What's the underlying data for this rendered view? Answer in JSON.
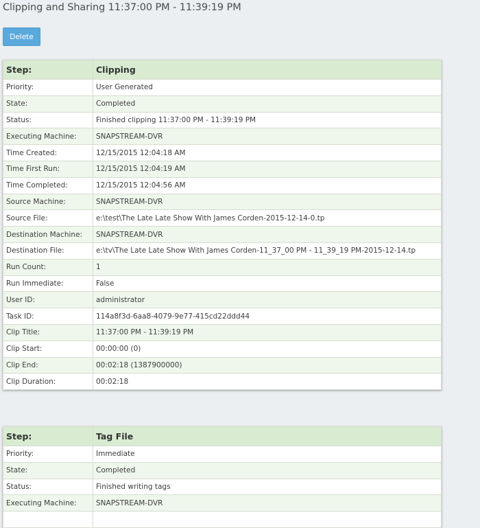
{
  "page": {
    "title": "Clipping and Sharing 11:37:00 PM - 11:39:19 PM",
    "delete_label": "Delete"
  },
  "colors": {
    "background": "#eceff1",
    "button": "#5aa9dc",
    "header_row": "#d9ecd2",
    "alt_row": "#eff7ec"
  },
  "steps": [
    {
      "header": {
        "label": "Step:",
        "value": "Clipping"
      },
      "rows": [
        {
          "label": "Priority:",
          "value": "User Generated"
        },
        {
          "label": "State:",
          "value": "Completed"
        },
        {
          "label": "Status:",
          "value": "Finished clipping 11:37:00 PM - 11:39:19 PM"
        },
        {
          "label": "Executing Machine:",
          "value": "SNAPSTREAM-DVR"
        },
        {
          "label": "Time Created:",
          "value": "12/15/2015 12:04:18 AM"
        },
        {
          "label": "Time First Run:",
          "value": "12/15/2015 12:04:19 AM"
        },
        {
          "label": "Time Completed:",
          "value": "12/15/2015 12:04:56 AM"
        },
        {
          "label": "Source Machine:",
          "value": "SNAPSTREAM-DVR"
        },
        {
          "label": "Source File:",
          "value": "e:\\test\\The Late Late Show With James Corden-2015-12-14-0.tp"
        },
        {
          "label": "Destination Machine:",
          "value": "SNAPSTREAM-DVR"
        },
        {
          "label": "Destination File:",
          "value": "e:\\tv\\The Late Late Show With James Corden-11_37_00 PM - 11_39_19 PM-2015-12-14.tp"
        },
        {
          "label": "Run Count:",
          "value": "1"
        },
        {
          "label": "Run Immediate:",
          "value": "False"
        },
        {
          "label": "User ID:",
          "value": "administrator"
        },
        {
          "label": "Task ID:",
          "value": "114a8f3d-6aa8-4079-9e77-415cd22ddd44"
        },
        {
          "label": "Clip Title:",
          "value": "11:37:00 PM - 11:39:19 PM"
        },
        {
          "label": "Clip Start:",
          "value": "00:00:00 (0)"
        },
        {
          "label": "Clip End:",
          "value": "00:02:18 (1387900000)"
        },
        {
          "label": "Clip Duration:",
          "value": "00:02:18"
        }
      ]
    },
    {
      "header": {
        "label": "Step:",
        "value": "Tag File"
      },
      "rows": [
        {
          "label": "Priority:",
          "value": "Immediate"
        },
        {
          "label": "State:",
          "value": "Completed"
        },
        {
          "label": "Status:",
          "value": "Finished writing tags"
        },
        {
          "label": "Executing Machine:",
          "value": "SNAPSTREAM-DVR"
        },
        {
          "label": "",
          "value": ""
        }
      ]
    }
  ]
}
